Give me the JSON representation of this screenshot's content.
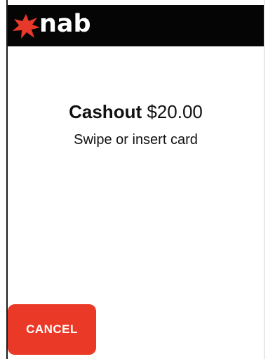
{
  "header": {
    "logo_text": "nab",
    "logo_icon": "nab-star-icon"
  },
  "transaction": {
    "type_label": "Cashout",
    "amount": "$20.00",
    "instruction": "Swipe or insert card"
  },
  "actions": {
    "cancel_label": "CANCEL"
  },
  "colors": {
    "header_bg": "#050505",
    "brand_red": "#e8382a",
    "cancel_bg": "#ea3a27",
    "text": "#111111"
  }
}
